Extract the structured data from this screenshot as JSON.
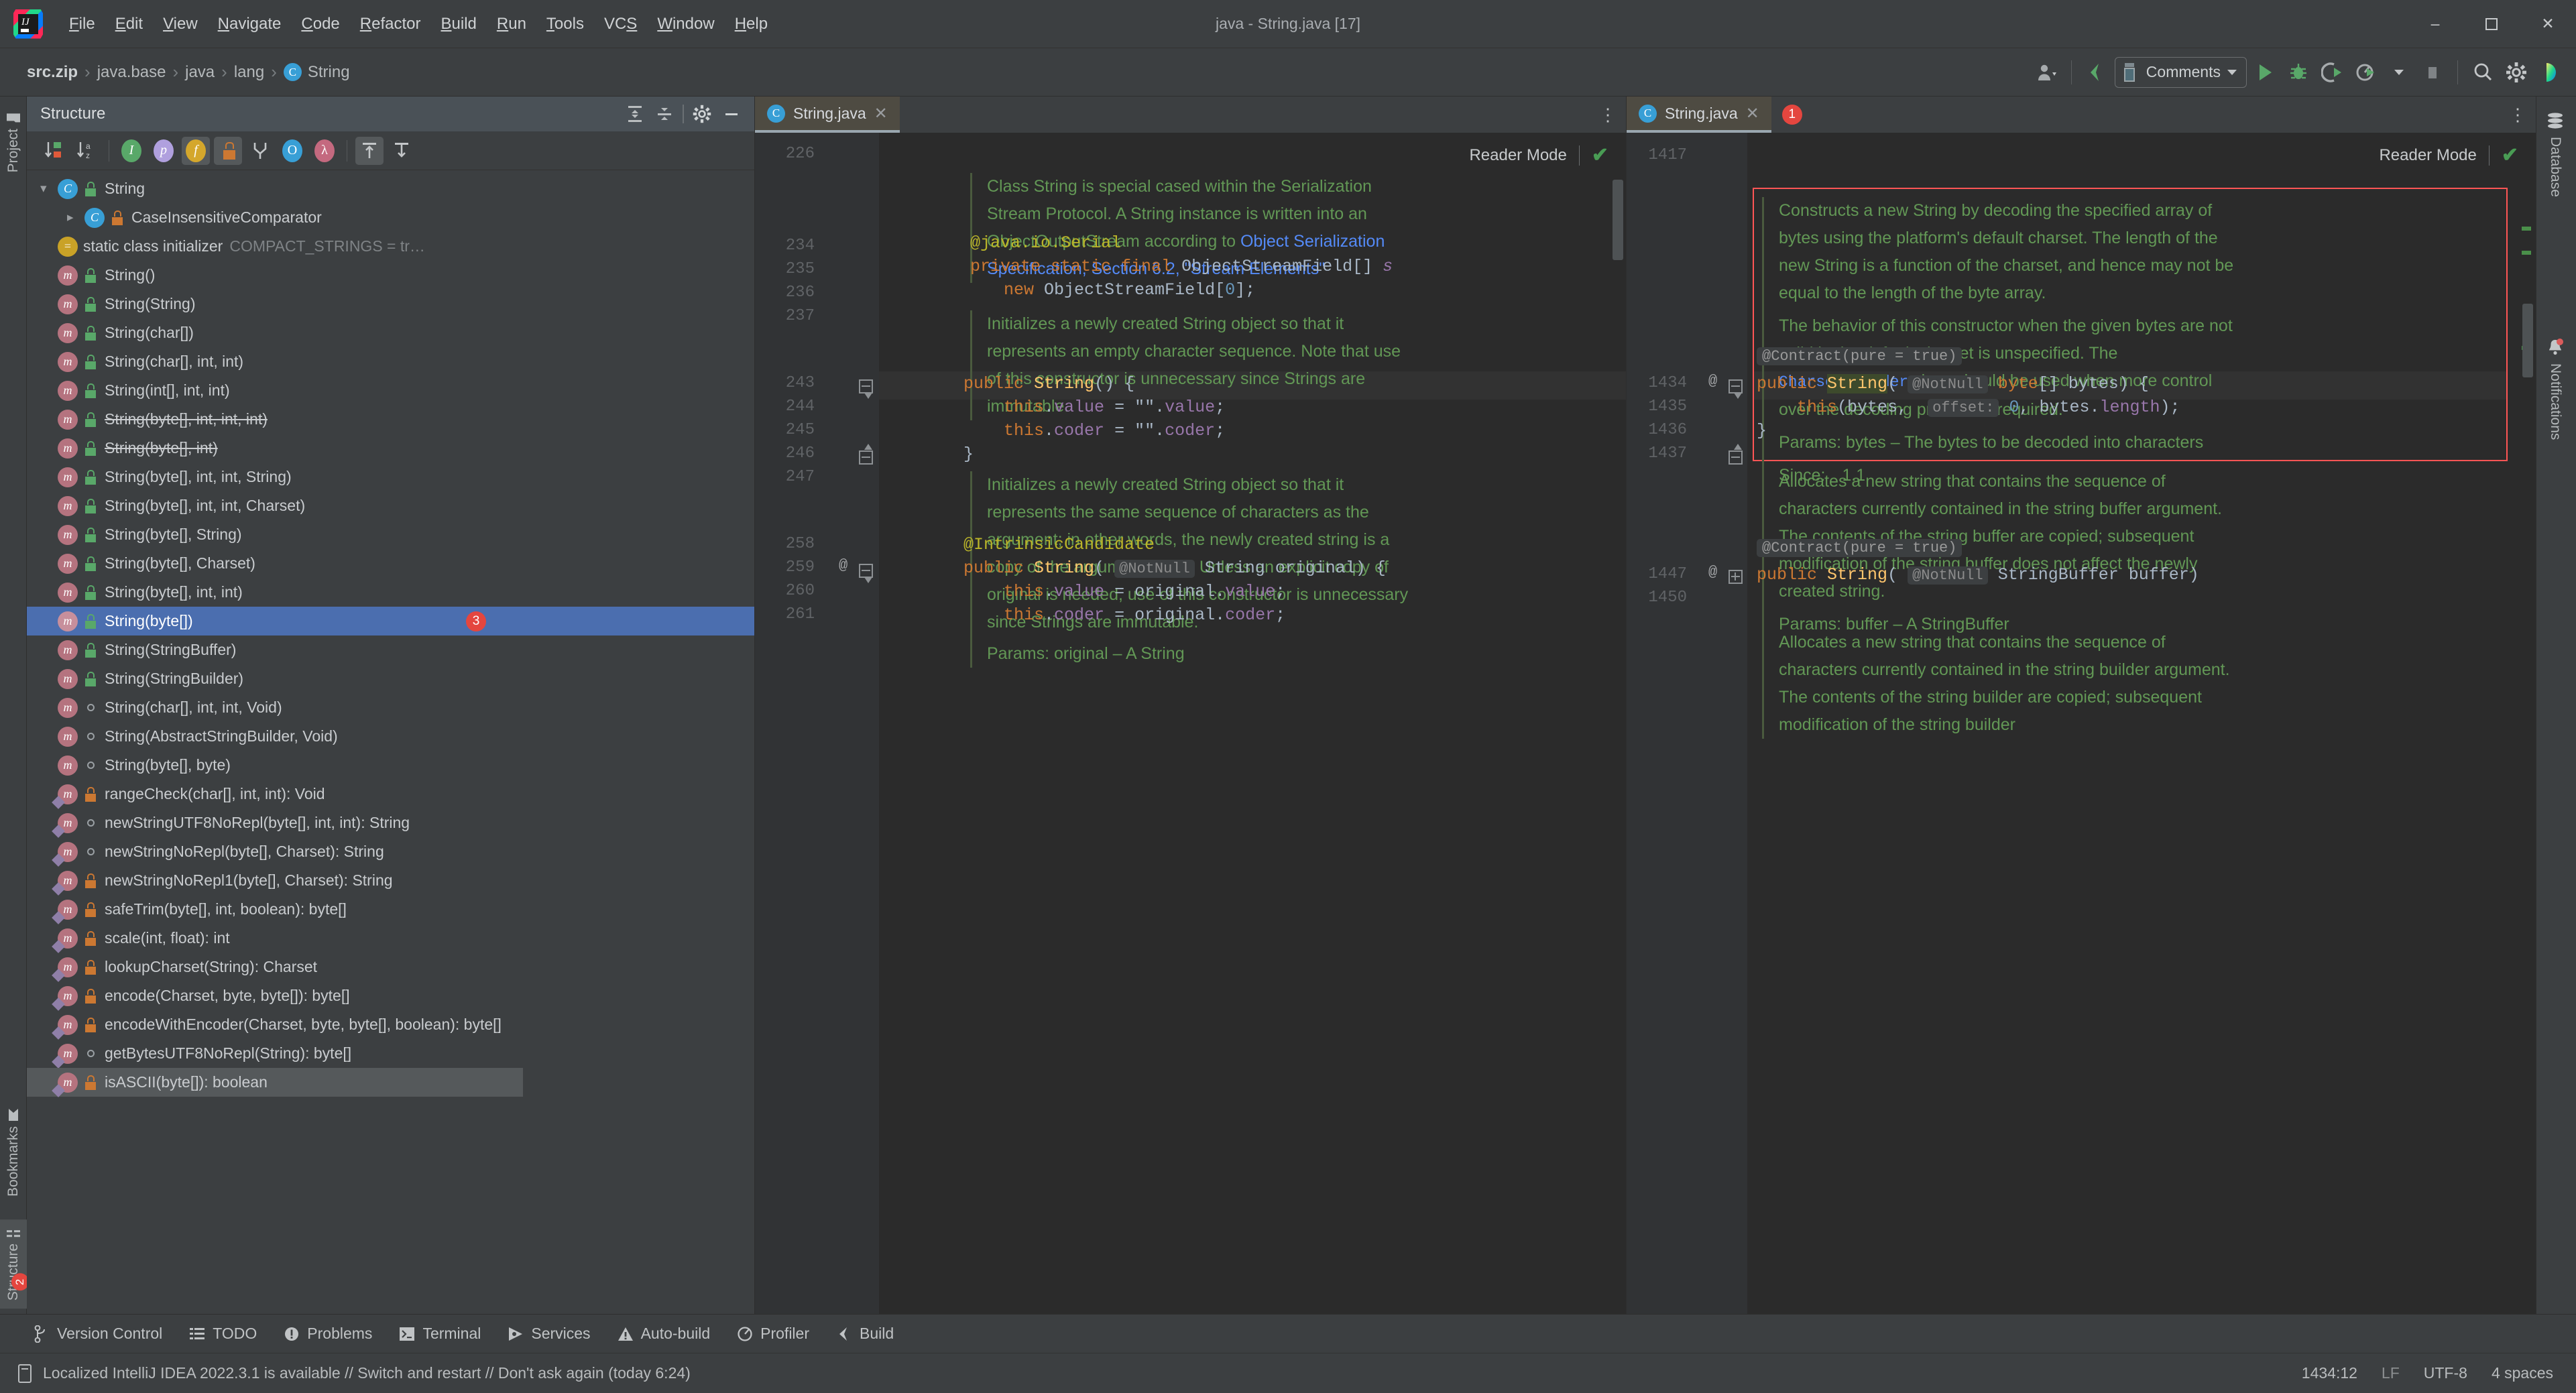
{
  "titlebar": {
    "app_icon": "intellij-idea-logo",
    "window_title": "java - String.java [17]",
    "menus": [
      {
        "label": "File",
        "mnemonic": "F"
      },
      {
        "label": "Edit",
        "mnemonic": "E"
      },
      {
        "label": "View",
        "mnemonic": "V"
      },
      {
        "label": "Navigate",
        "mnemonic": "N"
      },
      {
        "label": "Code",
        "mnemonic": "C"
      },
      {
        "label": "Refactor",
        "mnemonic": "R"
      },
      {
        "label": "Build",
        "mnemonic": "B"
      },
      {
        "label": "Run",
        "mnemonic": "R"
      },
      {
        "label": "Tools",
        "mnemonic": "T"
      },
      {
        "label": "VCS",
        "mnemonic": "S"
      },
      {
        "label": "Window",
        "mnemonic": "W"
      },
      {
        "label": "Help",
        "mnemonic": "H"
      }
    ],
    "minimize": "–",
    "maximize": "❐",
    "close": "✕"
  },
  "navbar": {
    "breadcrumbs": [
      "src.zip",
      "java.base",
      "java",
      "lang",
      "String"
    ],
    "class_icon_letter": "C",
    "separator": "›",
    "toolbar": {
      "profile_label": "profile-dropdown",
      "vcs_update_label": "vcs-update",
      "run_config": "Comments",
      "run_label": "run",
      "debug_label": "debug",
      "run_coverage_label": "run-with-coverage",
      "profiler_label": "profiler-dropdown",
      "stop_label": "stop",
      "search_label": "search-everywhere",
      "settings_label": "settings",
      "account_label": "account"
    }
  },
  "left_rail": {
    "top": [
      {
        "label": "Project",
        "icon": "folder-icon"
      }
    ],
    "bottom": [
      {
        "label": "Bookmarks",
        "icon": "bookmark-icon"
      },
      {
        "label": "Structure",
        "icon": "structure-icon",
        "active": true,
        "badge": "2"
      }
    ]
  },
  "right_rail": [
    {
      "label": "Database",
      "icon": "database-icon"
    },
    {
      "label": "Notifications",
      "icon": "bell-icon",
      "has_dot": true
    }
  ],
  "structure": {
    "title": "Structure",
    "header_buttons": [
      "expand-all-icon",
      "collapse-all-icon",
      "gear-icon",
      "hide-icon"
    ],
    "toolbar_buttons": [
      {
        "name": "sort-by-visibility-icon",
        "selected": false
      },
      {
        "name": "sort-alphabetically-icon",
        "selected": false
      },
      {
        "name": "show-inherited-icon",
        "letter": "I",
        "selected": false
      },
      {
        "name": "show-properties-icon",
        "letter": "p",
        "selected": false
      },
      {
        "name": "show-fields-icon",
        "letter": "f",
        "selected": true
      },
      {
        "name": "show-non-public-icon",
        "letter": "lock",
        "selected": true
      },
      {
        "name": "group-methods-icon",
        "selected": false
      },
      {
        "name": "show-anonymous-icon",
        "letter": "O",
        "selected": false
      },
      {
        "name": "show-lambdas-icon",
        "letter": "λ",
        "selected": false
      },
      {
        "name": "autoscroll-to-source-icon",
        "selected": true
      },
      {
        "name": "autoscroll-from-source-icon",
        "selected": false
      }
    ],
    "tree": [
      {
        "label": "String",
        "icon": "class-icon",
        "vis": "public",
        "depth": 0,
        "expanded": true
      },
      {
        "label": "CaseInsensitiveComparator",
        "icon": "class-icon",
        "vis": "private",
        "depth": 1,
        "collapsed": true,
        "override": true
      },
      {
        "label": "static class initializer",
        "sub": "COMPACT_STRINGS = tr…",
        "icon": "field-icon",
        "depth": 1,
        "override": true
      },
      {
        "label": "String()",
        "icon": "method-icon",
        "vis": "public",
        "depth": 1
      },
      {
        "label": "String(String)",
        "icon": "method-icon",
        "vis": "public",
        "depth": 1
      },
      {
        "label": "String(char[])",
        "icon": "method-icon",
        "vis": "public",
        "depth": 1
      },
      {
        "label": "String(char[], int, int)",
        "icon": "method-icon",
        "vis": "public",
        "depth": 1
      },
      {
        "label": "String(int[], int, int)",
        "icon": "method-icon",
        "vis": "public",
        "depth": 1
      },
      {
        "label": "String(byte[], int, int, int)",
        "icon": "method-icon",
        "vis": "public",
        "depth": 1,
        "deprecated": true
      },
      {
        "label": "String(byte[], int)",
        "icon": "method-icon",
        "vis": "public",
        "depth": 1,
        "deprecated": true
      },
      {
        "label": "String(byte[], int, int, String)",
        "icon": "method-icon",
        "vis": "public",
        "depth": 1
      },
      {
        "label": "String(byte[], int, int, Charset)",
        "icon": "method-icon",
        "vis": "public",
        "depth": 1
      },
      {
        "label": "String(byte[], String)",
        "icon": "method-icon",
        "vis": "public",
        "depth": 1
      },
      {
        "label": "String(byte[], Charset)",
        "icon": "method-icon",
        "vis": "public",
        "depth": 1
      },
      {
        "label": "String(byte[], int, int)",
        "icon": "method-icon",
        "vis": "public",
        "depth": 1
      },
      {
        "label": "String(byte[])",
        "icon": "method-icon",
        "vis": "public",
        "depth": 1,
        "selected": true,
        "badge": "3"
      },
      {
        "label": "String(StringBuffer)",
        "icon": "method-icon",
        "vis": "public",
        "depth": 1
      },
      {
        "label": "String(StringBuilder)",
        "icon": "method-icon",
        "vis": "public",
        "depth": 1
      },
      {
        "label": "String(char[], int, int, Void)",
        "icon": "method-icon",
        "vis": "package",
        "depth": 1
      },
      {
        "label": "String(AbstractStringBuilder, Void)",
        "icon": "method-icon",
        "vis": "package",
        "depth": 1
      },
      {
        "label": "String(byte[], byte)",
        "icon": "method-icon",
        "vis": "package",
        "depth": 1
      },
      {
        "label": "rangeCheck(char[], int, int): Void",
        "icon": "method-icon",
        "vis": "private",
        "depth": 1,
        "override": true
      },
      {
        "label": "newStringUTF8NoRepl(byte[], int, int): String",
        "icon": "method-icon",
        "vis": "package",
        "depth": 1,
        "override": true
      },
      {
        "label": "newStringNoRepl(byte[], Charset): String",
        "icon": "method-icon",
        "vis": "package",
        "depth": 1,
        "override": true
      },
      {
        "label": "newStringNoRepl1(byte[], Charset): String",
        "icon": "method-icon",
        "vis": "private",
        "depth": 1,
        "override": true
      },
      {
        "label": "safeTrim(byte[], int, boolean): byte[]",
        "icon": "method-icon",
        "vis": "private",
        "depth": 1,
        "override": true
      },
      {
        "label": "scale(int, float): int",
        "icon": "method-icon",
        "vis": "private",
        "depth": 1,
        "override": true
      },
      {
        "label": "lookupCharset(String): Charset",
        "icon": "method-icon",
        "vis": "private",
        "depth": 1,
        "override": true
      },
      {
        "label": "encode(Charset, byte, byte[]): byte[]",
        "icon": "method-icon",
        "vis": "private",
        "depth": 1,
        "override": true
      },
      {
        "label": "encodeWithEncoder(Charset, byte, byte[], boolean): byte[]",
        "icon": "method-icon",
        "vis": "private",
        "depth": 1,
        "override": true
      },
      {
        "label": "getBytesUTF8NoRepl(String): byte[]",
        "icon": "method-icon",
        "vis": "package",
        "depth": 1,
        "override": true
      },
      {
        "label": "isASCII(byte[]): boolean",
        "icon": "method-icon",
        "vis": "private",
        "depth": 1,
        "override": true,
        "hovered": true
      }
    ]
  },
  "editor_left": {
    "tab": {
      "label": "String.java",
      "icon": "java-class-icon",
      "close": "✕"
    },
    "reader_mode": {
      "label": "Reader Mode",
      "check": "✔"
    },
    "line_numbers": [
      "226",
      "234",
      "235",
      "236",
      "237",
      "243",
      "244",
      "245",
      "246",
      "247",
      "258",
      "259",
      "260",
      "261"
    ],
    "doc1": {
      "text_green_1": "Class String is special cased within the Serialization Stream Protocol. A String instance is written into an ObjectOutputStream according to ",
      "link_1": "Object Serialization Specification, Section 6.2, \"Stream Elements\""
    },
    "code1": {
      "l234": "@java.io.Serial",
      "l235_kw": "private static final",
      "l235_type": "ObjectStreamField[]",
      "l235_field": "s",
      "l236_new": "new",
      "l236_rest": "ObjectStreamField[",
      "l236_num": "0",
      "l236_end": "];"
    },
    "doc2": "Initializes a newly created String object so that it represents an empty character sequence. Note that use of this constructor is unnecessary since Strings are immutable.",
    "code2": {
      "l243": "public String() {",
      "l244": "this.value = \"\".value;",
      "l245": "this.coder = \"\".coder;",
      "l246": "}"
    },
    "doc3": "Initializes a newly created String object so that it represents the same sequence of characters as the argument; in other words, the newly created string is a copy of the argument string. Unless an explicit copy of original is needed, use of this constructor is unnecessary since Strings are immutable.",
    "doc3_params": "Params: original – A String",
    "code3": {
      "l258": "@IntrinsicCandidate",
      "l259": "public String( @NotNull String original) {",
      "l259_hint": "@NotNull",
      "l260": "this.value = original.value;",
      "l261": "this.coder = original.coder;"
    },
    "gutter_at_259": "@"
  },
  "editor_right": {
    "tab": {
      "label": "String.java",
      "icon": "java-class-icon",
      "close": "✕",
      "badge": "1"
    },
    "reader_mode": {
      "label": "Reader Mode",
      "check": "✔"
    },
    "line_numbers": [
      "1417",
      "1434",
      "1435",
      "1436",
      "1437",
      "1447",
      "1450"
    ],
    "doc1_p1": "Constructs a new String by decoding the specified array of bytes using the platform's default charset. The length of the new String is a function of the charset, and hence may not be equal to the length of the byte array.",
    "doc1_p2_a": "The behavior of this constructor when the given bytes are not valid in the default charset is unspecified. The ",
    "doc1_p2_link": "CharsetDecoder",
    "doc1_p2_b": " class should be used when more control over the decoding process is required.",
    "doc1_params": "Params: bytes – The bytes to be decoded into characters",
    "doc1_since_label": "Since:",
    "doc1_since_value": "1.1",
    "code1": {
      "contract": "@Contract(pure = true)",
      "l1434": "public String( @NotNull byte[] bytes) {",
      "l1434_hint": "@NotNull",
      "l1435": "this(bytes,  offset: 0, bytes.length);",
      "l1435_hint": "offset:",
      "l1436": "}"
    },
    "doc2": "Allocates a new string that contains the sequence of characters currently contained in the string buffer argument. The contents of the string buffer are copied; subsequent modification of the string buffer does not affect the newly created string.",
    "doc2_params": "Params: buffer – A StringBuffer",
    "code2": {
      "contract": "@Contract(pure = true)",
      "l1447": "public String( @NotNull StringBuffer buffer)",
      "l1447_hint": "@NotNull"
    },
    "doc3": "Allocates a new string that contains the sequence of characters currently contained in the string builder argument. The contents of the string builder are copied; subsequent modification of the string builder",
    "gutter_at_1434": "@",
    "gutter_at_1447": "@",
    "error_box_color": "#ff5555"
  },
  "bottom_bar": {
    "items": [
      {
        "label": "Version Control",
        "icon": "branch-icon"
      },
      {
        "label": "TODO",
        "icon": "list-icon"
      },
      {
        "label": "Problems",
        "icon": "warning-icon"
      },
      {
        "label": "Terminal",
        "icon": "terminal-icon"
      },
      {
        "label": "Services",
        "icon": "services-icon"
      },
      {
        "label": "Auto-build",
        "icon": "autobuild-icon"
      },
      {
        "label": "Profiler",
        "icon": "profiler-icon"
      },
      {
        "label": "Build",
        "icon": "build-icon"
      }
    ]
  },
  "statusbar": {
    "message": "Localized IntelliJ IDEA 2022.3.1 is available // Switch and restart // Don't ask again (today 6:24)",
    "message_icon": "notification-icon",
    "caret_position": "1434:12",
    "line_separator": "LF",
    "encoding": "UTF-8",
    "indent": "4 spaces"
  },
  "colors": {
    "accent_blue": "#4b6eaf",
    "doc_green": "#629755",
    "keyword_orange": "#cc7832",
    "class_yellow": "#ffc66d",
    "field_purple": "#9876aa",
    "number_blue": "#6897bb",
    "annotation_olive": "#bbb529",
    "link_blue": "#548af7",
    "error_red": "#ff5555",
    "badge_red": "#e4463f",
    "panel_bg": "#3c3f41",
    "editor_bg": "#2b2b2b"
  }
}
